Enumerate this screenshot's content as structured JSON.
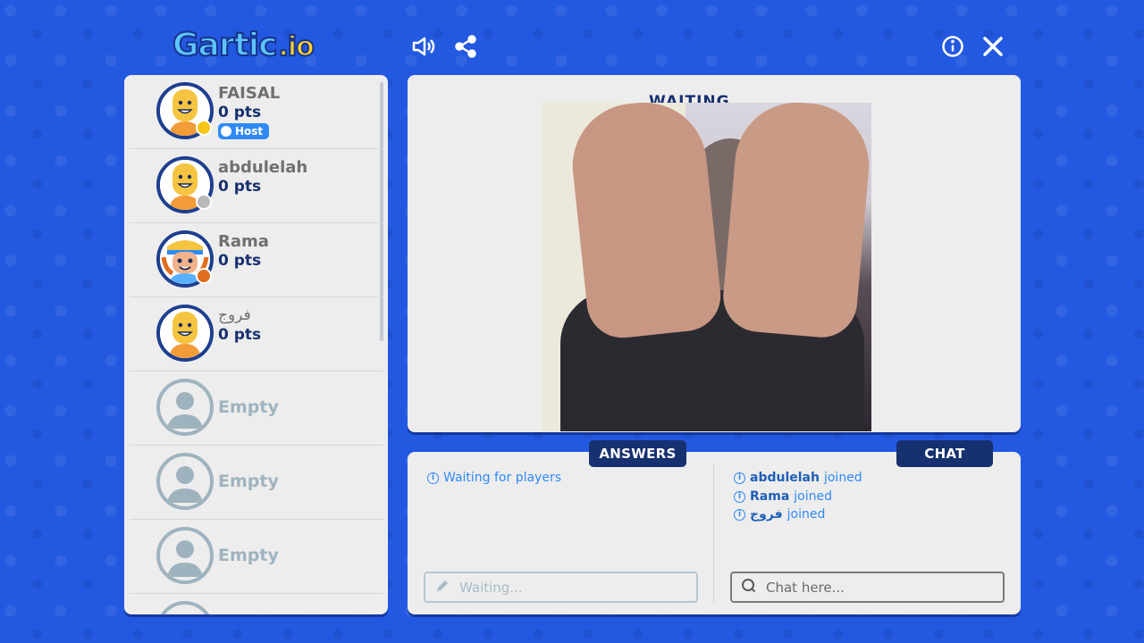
{
  "header": {
    "logo_main": "Gartic",
    "logo_suffix": ".io",
    "icons": [
      "sound-icon",
      "share-icon",
      "info-icon",
      "close-icon"
    ]
  },
  "players": [
    {
      "name": "FAISAL",
      "points": "0 pts",
      "badge": "Host",
      "status_color": "#f5c518",
      "avatar": "smiley"
    },
    {
      "name": "abdulelah",
      "points": "0 pts",
      "status_color": "#b8b8b8",
      "avatar": "smiley"
    },
    {
      "name": "Rama",
      "points": "0 pts",
      "status_color": "#e06d1f",
      "avatar": "cap-kid"
    },
    {
      "name": "فروج",
      "points": "0 pts",
      "status_color": "",
      "avatar": "smiley"
    },
    {
      "name": "Empty"
    },
    {
      "name": "Empty"
    },
    {
      "name": "Empty"
    }
  ],
  "canvas": {
    "title": "WAITING"
  },
  "answers": {
    "tab_label": "ANSWERS",
    "status_message": "Waiting for players",
    "input_placeholder": "Waiting..."
  },
  "chat": {
    "tab_label": "CHAT",
    "messages": [
      {
        "user": "abdulelah",
        "text": "joined"
      },
      {
        "user": "Rama",
        "text": "joined"
      },
      {
        "user": "فروج",
        "text": "joined"
      }
    ],
    "input_placeholder": "Chat here..."
  },
  "colors": {
    "background": "#2358e0",
    "navy": "#17306f",
    "accent_blue": "#2f8af5",
    "panel": "#ededed"
  }
}
